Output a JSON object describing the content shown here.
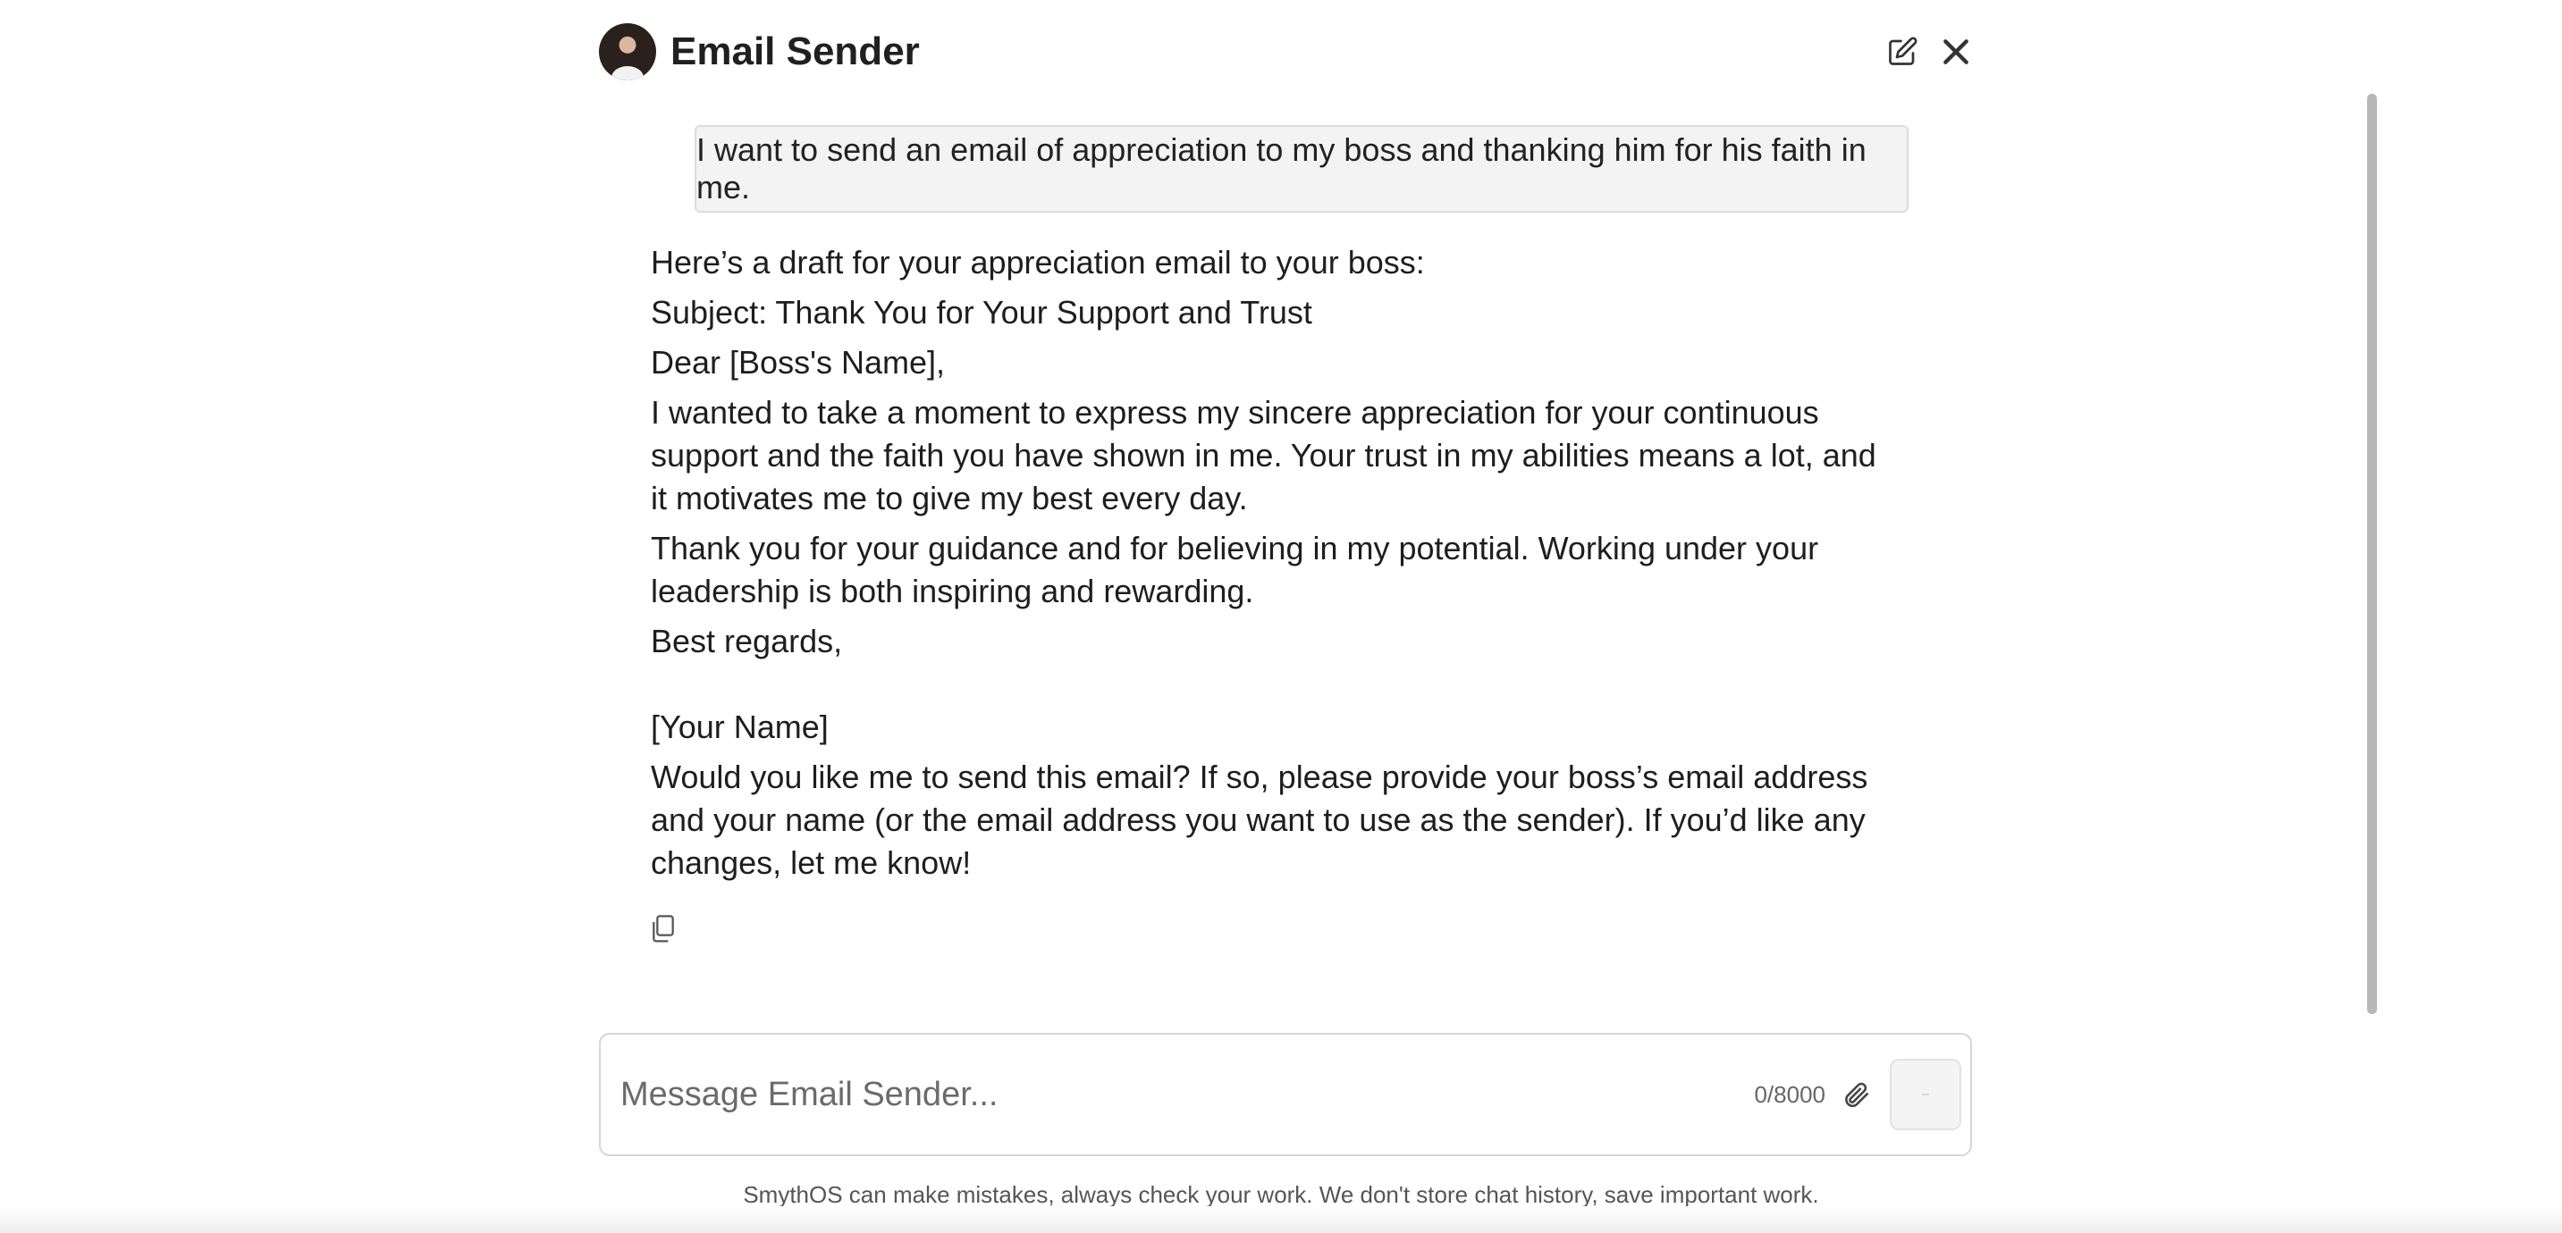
{
  "header": {
    "title": "Email Sender",
    "avatar_icon": "assistant-avatar",
    "edit_icon": "edit-icon",
    "close_icon": "close-icon"
  },
  "conversation": {
    "user_message": "I want to send an email of appreciation to my boss and thanking him for his faith in me.",
    "assistant_reply": {
      "intro": "Here’s a draft for your appreciation email to your boss:",
      "subject": "Subject: Thank You for Your Support and Trust",
      "greeting": "Dear [Boss's Name],",
      "paragraph1": "I wanted to take a moment to express my sincere appreciation for your continuous support and the faith you have shown in me. Your trust in my abilities means a lot, and it motivates me to give my best every day.",
      "paragraph2": "Thank you for your guidance and for believing in my potential. Working under your leadership is both inspiring and rewarding.",
      "closing": "Best regards,",
      "signature": "[Your Name]",
      "followup": "Would you like me to send this email? If so, please provide your boss’s email address and your name (or the email address you want to use as the sender). If you’d like any changes, let me know!"
    },
    "copy_icon": "copy-icon"
  },
  "composer": {
    "placeholder": "Message Email Sender...",
    "value": "",
    "counter": "0/8000",
    "attach_icon": "paperclip-icon",
    "send_icon": "send-icon"
  },
  "footer": {
    "disclaimer": "SmythOS can make mistakes, always check your work. We don't store chat history, save important work."
  }
}
